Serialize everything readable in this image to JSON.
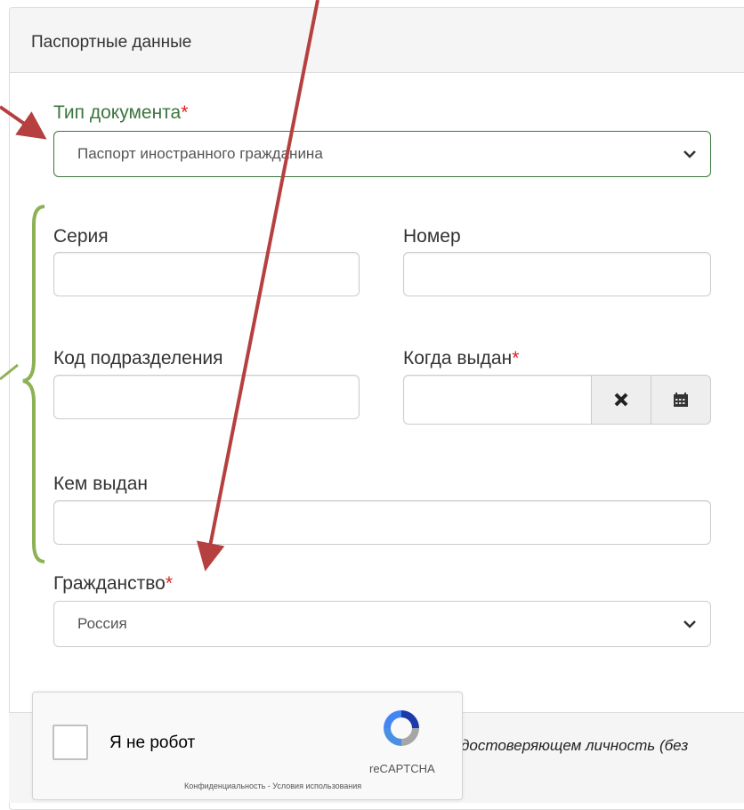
{
  "panel": {
    "title": "Паспортные данные"
  },
  "document_type": {
    "label": "Тип документа",
    "required_mark": "*",
    "value": "Паспорт иностранного гражданина"
  },
  "series": {
    "label": "Серия",
    "value": ""
  },
  "number": {
    "label": "Номер",
    "value": ""
  },
  "division_code": {
    "label": "Код подразделения",
    "value": ""
  },
  "issue_date": {
    "label": "Когда выдан",
    "required_mark": "*",
    "value": "",
    "clear_icon": "times-icon",
    "calendar_icon": "calendar-icon"
  },
  "issued_by": {
    "label": "Кем выдан",
    "value": ""
  },
  "citizenship": {
    "label": "Гражданство",
    "required_mark": "*",
    "value": "Россия"
  },
  "recaptcha": {
    "label": "Я не робот",
    "brand": "reCAPTCHA",
    "links": "Конфиденциальность - Условия использования"
  },
  "footer_text": "достоверяющем личность (без",
  "colors": {
    "accent_arrow": "#b5403f",
    "bracket": "#8db255",
    "success": "#3c763d",
    "required": "#e02020"
  }
}
